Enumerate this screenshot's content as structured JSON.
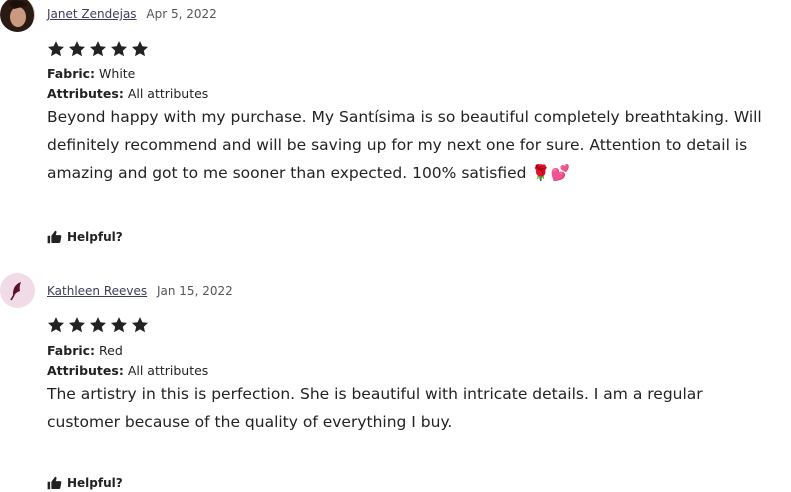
{
  "reviews": [
    {
      "name": "Janet Zendejas",
      "date": "Apr 5, 2022",
      "rating": 5,
      "attributes": [
        {
          "key": "Fabric:",
          "value": "White"
        },
        {
          "key": "Attributes:",
          "value": "All attributes"
        }
      ],
      "text": "Beyond happy with my purchase. My Santísima is so beautiful completely breathtaking. Will definitely recommend and will be saving up for my next one for sure. Attention to detail is amazing and got to me sooner than expected. 100% satisfied 🌹💕",
      "helpful_label": "Helpful?"
    },
    {
      "name": "Kathleen Reeves",
      "date": "Jan 15, 2022",
      "rating": 5,
      "attributes": [
        {
          "key": "Fabric:",
          "value": "Red"
        },
        {
          "key": "Attributes:",
          "value": "All attributes"
        }
      ],
      "text": "The artistry in this is perfection. She is beautiful with intricate details. I am a regular customer because of the quality of everything I buy.",
      "helpful_label": "Helpful?"
    }
  ],
  "colors": {
    "star": "#222222",
    "name": "#3d3d5c",
    "avatar2_bg": "#f1dbe6",
    "avatar2_mark": "#5a1030"
  }
}
